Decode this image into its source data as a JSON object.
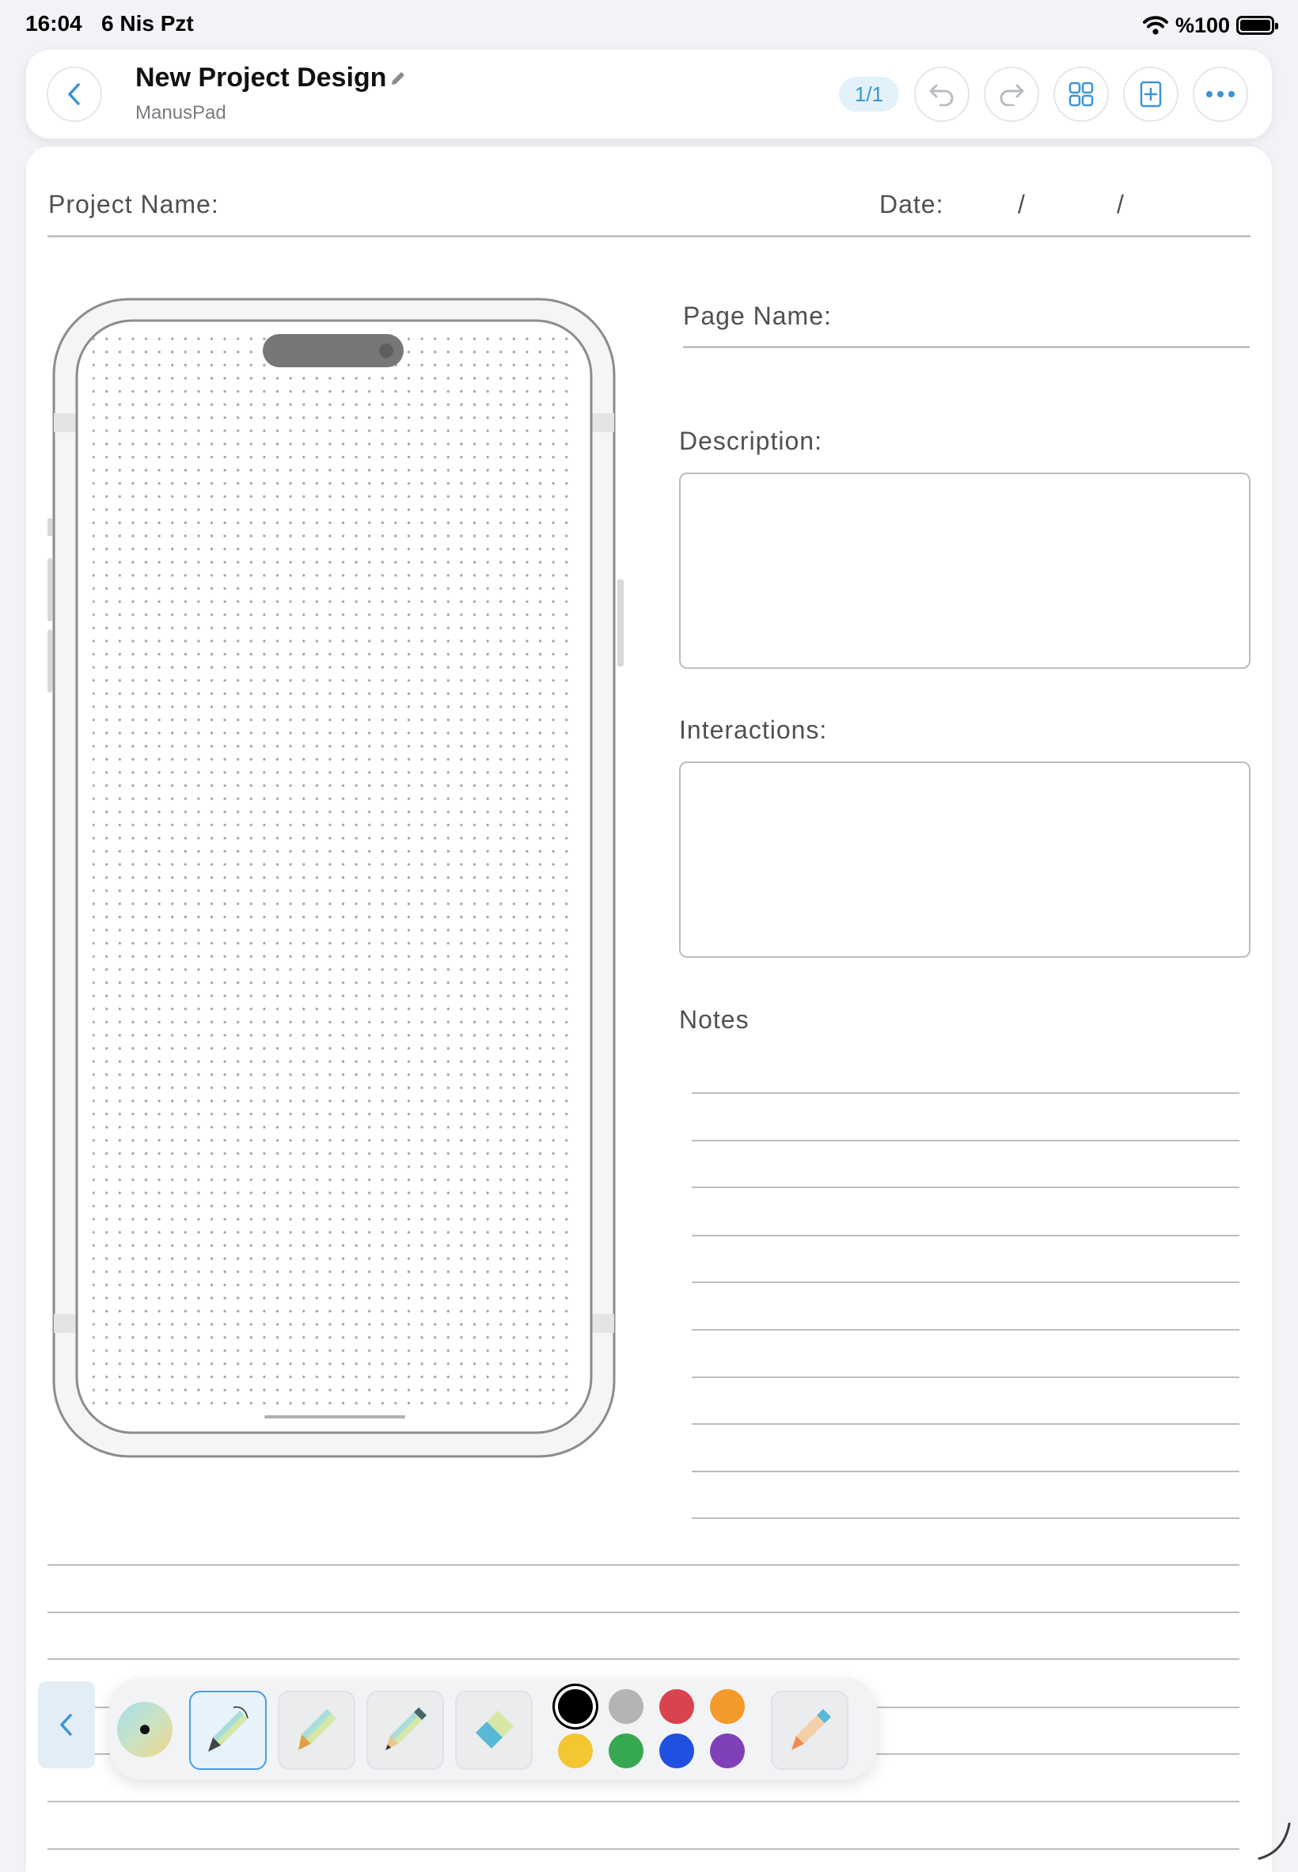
{
  "status_bar": {
    "time": "16:04",
    "date": "6 Nis Pzt",
    "battery": "%100"
  },
  "header": {
    "title": "New Project Design",
    "subtitle": "ManusPad",
    "page_indicator": "1/1",
    "icons": [
      "chevron-left-icon",
      "pencil-icon",
      "undo-icon",
      "redo-icon",
      "grid-icon",
      "add-page-icon",
      "more-icon"
    ]
  },
  "template": {
    "project_name_label": "Project Name:",
    "date_label": "Date:",
    "date_separator_1": "/",
    "date_separator_2": "/",
    "page_name_label": "Page Name:",
    "description_label": "Description:",
    "interactions_label": "Interactions:",
    "notes_label": "Notes"
  },
  "toolbar": {
    "tools": [
      "fountain-pen",
      "marker",
      "pencil",
      "eraser",
      "lasso-pen"
    ],
    "active_tool": "fountain-pen",
    "colors": [
      "#000000",
      "#b4b4b4",
      "#d9434f",
      "#f39a2b",
      "#f3c632",
      "#35a850",
      "#2050e0",
      "#8040b8"
    ],
    "selected_color": "#000000",
    "accent": "#3a94d4"
  }
}
